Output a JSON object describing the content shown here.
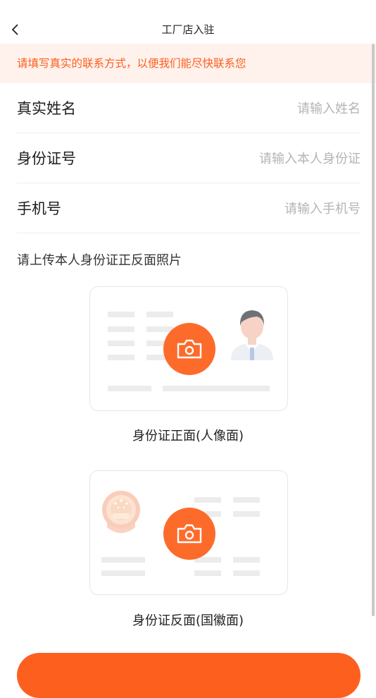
{
  "header": {
    "title": "工厂店入驻"
  },
  "notice": {
    "text": "请填写真实的联系方式，以便我们能尽快联系您"
  },
  "fields": [
    {
      "label": "真实姓名",
      "placeholder": "请输入姓名"
    },
    {
      "label": "身份证号",
      "placeholder": "请输入本人身份证"
    },
    {
      "label": "手机号",
      "placeholder": "请输入手机号"
    }
  ],
  "upload": {
    "title": "请上传本人身份证正反面照片",
    "front_caption": "身份证正面(人像面)",
    "back_caption": "身份证反面(国徽面)"
  },
  "submit": {
    "label": ""
  },
  "colors": {
    "accent": "#fd5f1f",
    "notice_bg": "#fff2ec"
  }
}
